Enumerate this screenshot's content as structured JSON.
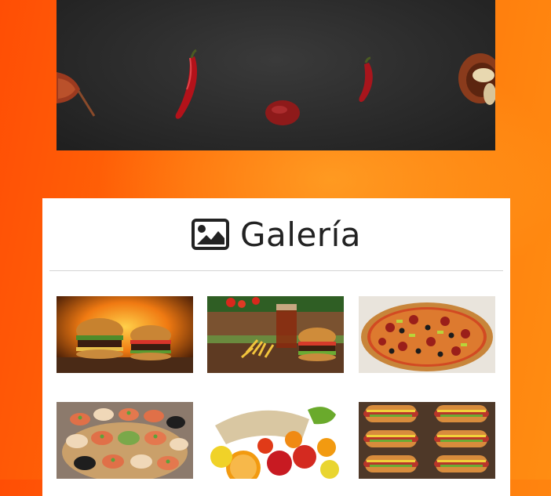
{
  "gallery": {
    "title": "Galería",
    "icon": "image-icon",
    "items": [
      {
        "name": "burgers-fire"
      },
      {
        "name": "burger-fries-soda"
      },
      {
        "name": "pizza"
      },
      {
        "name": "canapes"
      },
      {
        "name": "fruit-basket"
      },
      {
        "name": "hot-dogs"
      }
    ]
  },
  "colors": {
    "background_start": "#ff4e05",
    "background_end": "#ff8d12",
    "card": "#ffffff",
    "hero": "#2b2b2b"
  }
}
